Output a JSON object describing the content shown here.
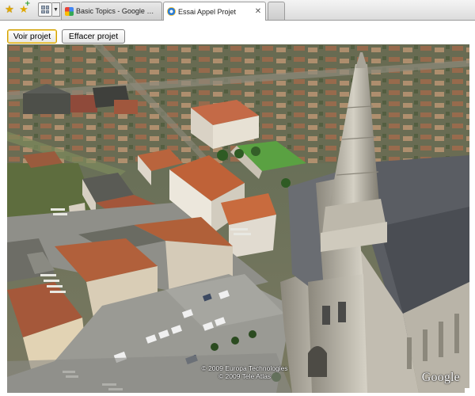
{
  "browser": {
    "tabs": [
      {
        "label": "Basic Topics - Google Earth A...",
        "active": false,
        "favicon": "google-favicon-icon"
      },
      {
        "label": "Essai Appel Projet",
        "active": true,
        "favicon": "ie-page-favicon-icon"
      }
    ],
    "close_glyph": "✕",
    "toolbar_icons": [
      "favorites-star-icon",
      "add-favorites-icon",
      "quick-tabs-icon",
      "tab-list-arrow-icon"
    ]
  },
  "page": {
    "buttons": {
      "voir_projet": "Voir projet",
      "effacer_projet": "Effacer projet"
    }
  },
  "earth_view": {
    "copyright_line1": "© 2009 Europa Technologies",
    "copyright_line2": "© 2009 Tele Atlas",
    "logo": "Google"
  },
  "colors": {
    "focus_border": "#d0a000",
    "roof_tile": "#b5633c",
    "street": "#8a8a86",
    "church_stone": "#c9c4b6"
  }
}
